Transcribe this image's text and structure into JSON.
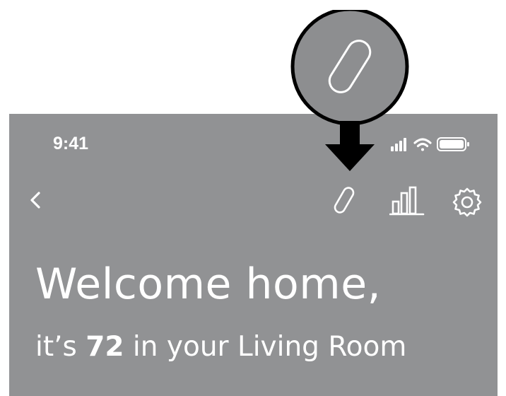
{
  "status_bar": {
    "time": "9:41"
  },
  "nav": {
    "back_icon": "chevron-left-icon",
    "icons": [
      "link-icon",
      "bar-chart-icon",
      "gear-icon"
    ]
  },
  "welcome": {
    "title": "Welcome home,",
    "subtitle_prefix": "it’s ",
    "temperature": "72",
    "subtitle_suffix": " in your Living Room"
  },
  "callout": {
    "icon": "link-icon",
    "arrow": "arrow-down-icon"
  },
  "colors": {
    "screen_background": "#919294",
    "callout_fill": "#8d8e90",
    "arrow": "#000000",
    "text": "#ffffff"
  }
}
